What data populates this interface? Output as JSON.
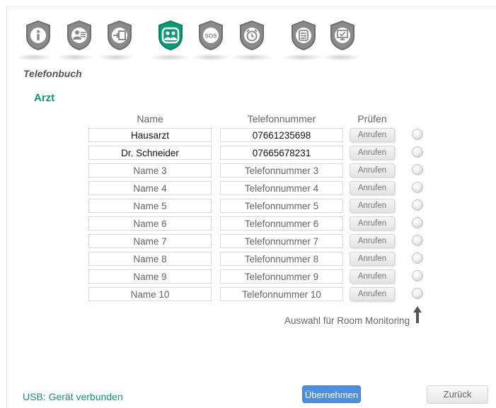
{
  "nav": {
    "icons": [
      {
        "name": "info-icon",
        "active": false
      },
      {
        "name": "user-list-icon",
        "active": false
      },
      {
        "name": "sign-in-icon",
        "active": false
      },
      {
        "name": "contacts-icon",
        "active": true
      },
      {
        "name": "sos-icon",
        "active": false,
        "label": "SOS"
      },
      {
        "name": "alarm-clock-icon",
        "active": false
      },
      {
        "name": "sliders-icon",
        "active": false
      },
      {
        "name": "monitor-check-icon",
        "active": false
      }
    ]
  },
  "page": {
    "title": "Telefonbuch",
    "section": "Arzt"
  },
  "table": {
    "headers": {
      "name": "Name",
      "phone": "Telefonnummer",
      "check": "Prüfen"
    },
    "call_label": "Anrufen",
    "rows": [
      {
        "name": "Hausarzt",
        "phone": "07661235698",
        "filled": true
      },
      {
        "name": "Dr. Schneider",
        "phone": "07665678231",
        "filled": true
      },
      {
        "name": "Name 3",
        "phone": "Telefonnummer 3",
        "filled": false
      },
      {
        "name": "Name 4",
        "phone": "Telefonnummer 4",
        "filled": false
      },
      {
        "name": "Name 5",
        "phone": "Telefonnummer 5",
        "filled": false
      },
      {
        "name": "Name 6",
        "phone": "Telefonnummer 6",
        "filled": false
      },
      {
        "name": "Name 7",
        "phone": "Telefonnummer 7",
        "filled": false
      },
      {
        "name": "Name 8",
        "phone": "Telefonnummer 8",
        "filled": false
      },
      {
        "name": "Name 9",
        "phone": "Telefonnummer 9",
        "filled": false
      },
      {
        "name": "Name 10",
        "phone": "Telefonnummer 10",
        "filled": false
      }
    ]
  },
  "monitoring_note": "Auswahl für Room Monitoring",
  "footer": {
    "status": "USB: Gerät verbunden",
    "apply_label": "Übernehmen",
    "back_label": "Zurück"
  },
  "colors": {
    "accent_green": "#0a9a78",
    "inactive_grey": "#8a8a8a",
    "apply_blue": "#4a90e2"
  }
}
